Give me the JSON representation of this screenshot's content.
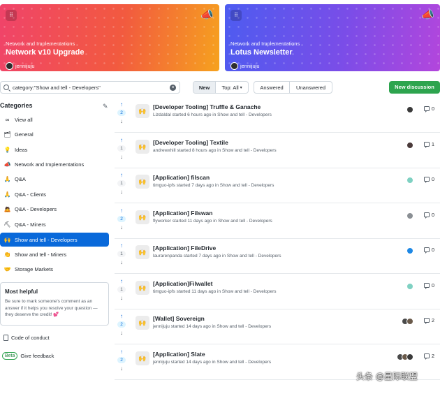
{
  "banners": [
    {
      "category": "Network and Implementations",
      "title": "Network v10 Upgrade",
      "author": "jennijuju",
      "colors": [
        "#f0436a",
        "#f6a21e"
      ]
    },
    {
      "category": "Network and Implementations",
      "title": "Lotus Newsletter",
      "author": "jennijuju",
      "colors": [
        "#4d5cf0",
        "#b346dc"
      ]
    }
  ],
  "search": {
    "value": "category:\"Show and tell - Developers\""
  },
  "filters": {
    "new": "New",
    "top": "Top: All",
    "answered": "Answered",
    "unanswered": "Unanswered"
  },
  "new_discussion": "New discussion",
  "categories": {
    "heading": "Categories",
    "items": [
      {
        "icon": "∞",
        "label": "View all"
      },
      {
        "icon": "🗂",
        "label": "General"
      },
      {
        "icon": "💡",
        "label": "Ideas"
      },
      {
        "icon": "📣",
        "label": "Network and Implementations"
      },
      {
        "icon": "🙏",
        "label": "Q&A"
      },
      {
        "icon": "🙏",
        "label": "Q&A - Clients"
      },
      {
        "icon": "🙇",
        "label": "Q&A - Developers"
      },
      {
        "icon": "⛏",
        "label": "Q&A - Miners"
      },
      {
        "icon": "🙌",
        "label": "Show and tell - Developers",
        "selected": true
      },
      {
        "icon": "👏",
        "label": "Show and tell - Miners"
      },
      {
        "icon": "🤝",
        "label": "Storage Markets"
      }
    ]
  },
  "most_helpful": {
    "title": "Most helpful",
    "text": "Be sure to mark someone's comment as an answer if it helps you resolve your question — they deserve the credit! 💕"
  },
  "code_of_conduct": "Code of conduct",
  "beta": {
    "badge": "Beta",
    "label": "Give feedback"
  },
  "discussions": [
    {
      "votes": "2",
      "title": "[Developer Tooling] Truffle & Ganache",
      "meta": "Lizdaldal started 6 hours ago in Show and tell - Developers",
      "avatars": [
        "#3a3a3a"
      ],
      "comments": "0"
    },
    {
      "votes": "1",
      "title": "[Developer Tooling] Textile",
      "meta": "andrewxhill started 8 hours ago in Show and tell - Developers",
      "avatars": [
        "#4a3a3a"
      ],
      "comments": "1"
    },
    {
      "votes": "1",
      "title": "[Application] filscan",
      "meta": "timguo-ipfs started 7 days ago in Show and tell - Developers",
      "avatars": [
        "#7fd1c2"
      ],
      "comments": "0"
    },
    {
      "votes": "2",
      "title": "[Application] Filswan",
      "meta": "flyworker started 11 days ago in Show and tell - Developers",
      "avatars": [
        "#8a8f94"
      ],
      "comments": "0"
    },
    {
      "votes": "1",
      "title": "[Application] FileDrive",
      "meta": "laurarenpanda started 7 days ago in Show and tell - Developers",
      "avatars": [
        "#1e88e5"
      ],
      "comments": "0"
    },
    {
      "votes": "1",
      "title": "[Application]Filwallet",
      "meta": "timguo-ipfs started 11 days ago in Show and tell - Developers",
      "avatars": [
        "#7fd1c2"
      ],
      "comments": "0"
    },
    {
      "votes": "2",
      "title": "[Wallet] Sovereign",
      "meta": "jennijuju started 14 days ago in Show and tell - Developers",
      "avatars": [
        "#4a4a4a",
        "#6a5a4a"
      ],
      "comments": "2"
    },
    {
      "votes": "2",
      "title": "[Application] Slate",
      "meta": "jennijuju started 14 days ago in Show and tell - Developers",
      "avatars": [
        "#4a4a4a",
        "#6a5a4a",
        "#3a3a3a"
      ],
      "comments": "2"
    }
  ],
  "watermark": "头条 @星际联盟"
}
